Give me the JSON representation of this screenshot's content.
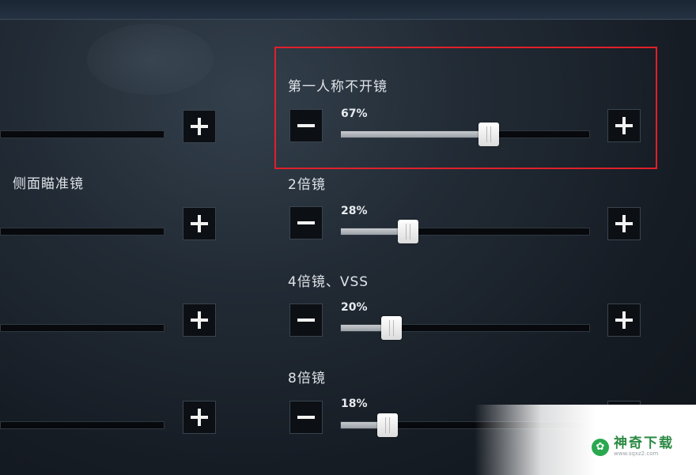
{
  "left_panel": {
    "label_side_scope": "侧面瞄准镜"
  },
  "right_panel": {
    "sliders": [
      {
        "label": "第一人称不开镜",
        "percent_text": "67%",
        "value": 67
      },
      {
        "label": "2倍镜",
        "percent_text": "28%",
        "value": 28
      },
      {
        "label": "4倍镜、VSS",
        "percent_text": "20%",
        "value": 20
      },
      {
        "label": "8倍镜",
        "percent_text": "18%",
        "value": 18
      }
    ]
  },
  "icons": {
    "minus": "minus-icon",
    "plus": "plus-icon"
  },
  "colors": {
    "highlight_border": "#e0202a",
    "watermark_green": "#2d8a45"
  },
  "watermark": {
    "title": "神奇下载",
    "url": "www.sqxz2.com"
  }
}
